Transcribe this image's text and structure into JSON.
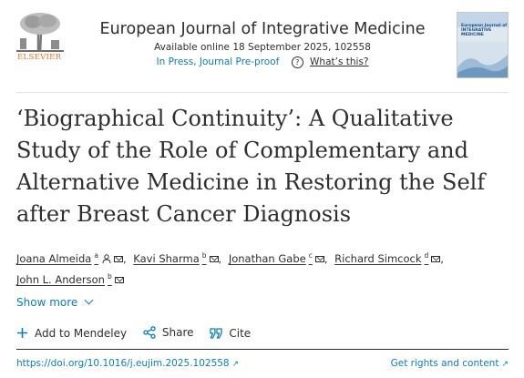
{
  "header": {
    "publisher_logo": "ELSEVIER",
    "journal_title": "European Journal of Integrative Medicine",
    "available_online": "Available online 18 September 2025, 102558",
    "status": "In Press, Journal Pre-proof",
    "whats_this": "What’s this?",
    "cover_text": "European Journal of INTEGRATIVE MEDICINE"
  },
  "article": {
    "title": "‘Biographical Continuity’: A Qualitative Study of the Role of Complementary and Alternative Medicine in Restoring the Self after Breast Cancer Diagnosis"
  },
  "authors": [
    {
      "name": "Joana Almeida",
      "aff": "a"
    },
    {
      "name": "Kavi Sharma",
      "aff": "b"
    },
    {
      "name": "Jonathan Gabe",
      "aff": "c"
    },
    {
      "name": "Richard Simcock",
      "aff": "d"
    },
    {
      "name": "John L. Anderson",
      "aff": "b"
    }
  ],
  "show_more": "Show more",
  "actions": {
    "mendeley": "Add to Mendeley",
    "share": "Share",
    "cite": "Cite"
  },
  "footer": {
    "doi": "https://doi.org/10.1016/j.eujim.2025.102558",
    "rights": "Get rights and content"
  },
  "icons": {
    "help": "help-circle-icon",
    "author_person": "person-icon",
    "email": "mail-icon",
    "show_more": "chevron-down-icon",
    "mendeley": "plus-icon",
    "share": "share-icon",
    "cite": "quote-icon",
    "external": "external-link-icon"
  },
  "colors": {
    "link": "#0c7dbb",
    "text": "#2e2e2e",
    "elsevier_orange": "#e9711c"
  }
}
